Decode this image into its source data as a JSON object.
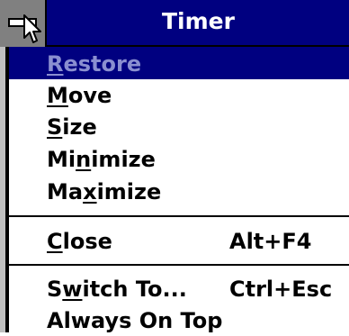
{
  "window": {
    "title": "Timer"
  },
  "system_menu": {
    "items": [
      {
        "pre": "",
        "key": "R",
        "post": "estore",
        "accel": "",
        "selected": true,
        "disabled": true
      },
      {
        "pre": "",
        "key": "M",
        "post": "ove",
        "accel": ""
      },
      {
        "pre": "",
        "key": "S",
        "post": "ize",
        "accel": ""
      },
      {
        "pre": "Mi",
        "key": "n",
        "post": "imize",
        "accel": ""
      },
      {
        "pre": "Ma",
        "key": "x",
        "post": "imize",
        "accel": ""
      },
      {
        "pre": "",
        "key": "C",
        "post": "lose",
        "accel": "Alt+F4"
      },
      {
        "pre": "S",
        "key": "w",
        "post": "itch To...",
        "accel": "Ctrl+Esc"
      },
      {
        "pre": "Always On Top",
        "key": "",
        "post": "",
        "accel": ""
      }
    ]
  },
  "colors": {
    "titlebar": "#000080",
    "selection": "#000080",
    "disabled_text": "#8a8fd0",
    "frame": "#c0c0c0",
    "system_box": "#808080"
  },
  "icons": [
    "system-menu-icon",
    "mouse-pointer-icon"
  ]
}
